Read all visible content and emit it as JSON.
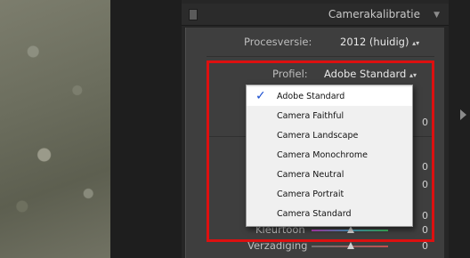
{
  "panel": {
    "title": "Camerakalibratie",
    "chevron_icon": "triangle-down-icon"
  },
  "process_version": {
    "label": "Procesversie:",
    "value": "2012 (huidig)"
  },
  "profile": {
    "label": "Profiel:",
    "value": "Adobe Standard"
  },
  "dropdown": {
    "selected_index": 0,
    "items": [
      "Adobe Standard",
      "Camera Faithful",
      "Camera Landscape",
      "Camera Monochrome",
      "Camera Neutral",
      "Camera Portrait",
      "Camera Standard"
    ]
  },
  "hidden_values": [
    "0",
    "0",
    "0",
    "0"
  ],
  "sliders": [
    {
      "label": "Kleurtoon",
      "value": "0"
    },
    {
      "label": "Verzadiging",
      "value": "0"
    }
  ],
  "colors": {
    "highlight_border": "#dd1010",
    "check_mark": "#1a4fd0",
    "dropdown_bg": "#f0f0f0"
  }
}
